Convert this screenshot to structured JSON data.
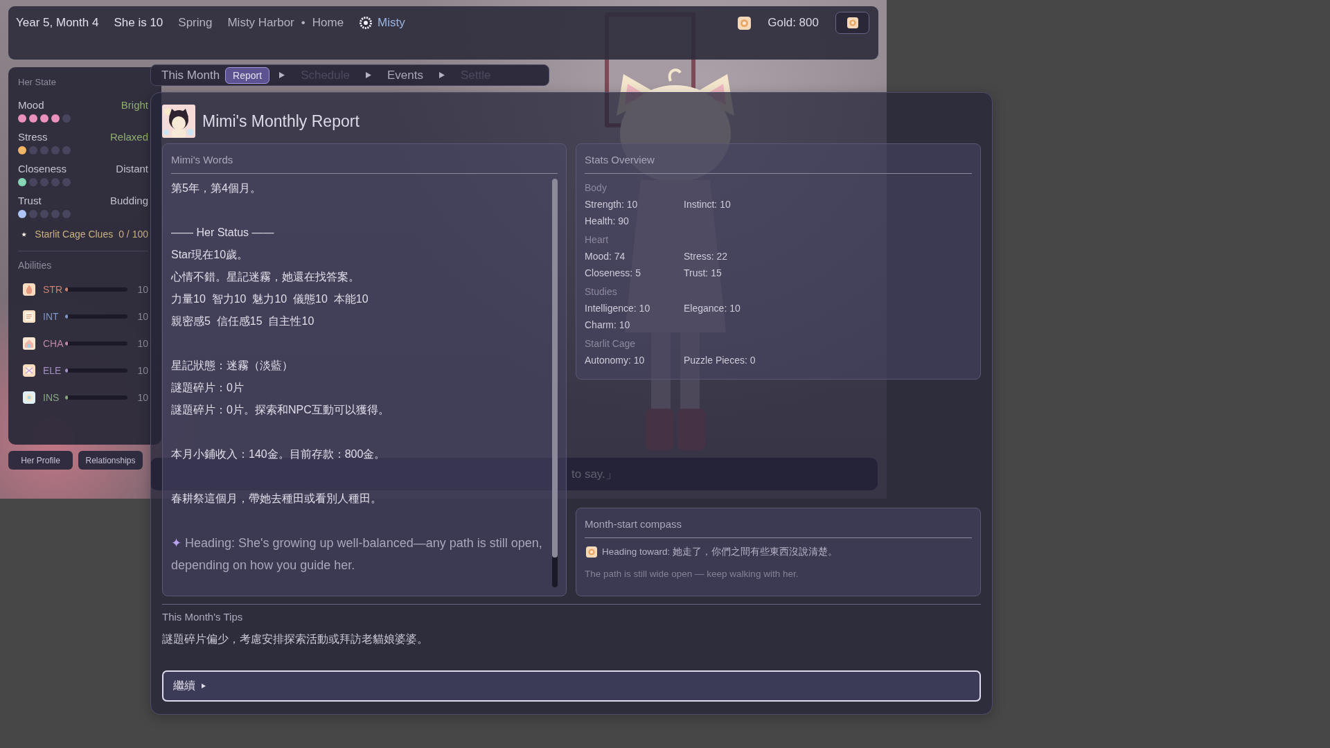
{
  "top_bar": {
    "date": "Year 5, Month 4",
    "age": "She is 10",
    "season": "Spring",
    "location": "Misty Harbor",
    "separator": "•",
    "place": "Home",
    "weather": "Misty",
    "gold": "Gold: 800"
  },
  "steps_bar": {
    "label": "This Month",
    "steps": [
      {
        "label": "Report",
        "selected": true,
        "disabled": false
      },
      {
        "label": "Schedule",
        "selected": false,
        "disabled": true
      },
      {
        "label": "Events",
        "selected": false,
        "disabled": false
      },
      {
        "label": "Settle",
        "selected": false,
        "disabled": true
      }
    ]
  },
  "her_state": {
    "title": "Her State",
    "meters": [
      {
        "label": "Mood",
        "value": "Bright",
        "positive": true,
        "stars": 4,
        "color": "#e991bb"
      },
      {
        "label": "Stress",
        "value": "Relaxed",
        "positive": true,
        "stars": 1,
        "color": "#f3b566"
      },
      {
        "label": "Closeness",
        "value": "Distant",
        "positive": false,
        "stars": 1,
        "color": "#86d6b6"
      },
      {
        "label": "Trust",
        "value": "Budding",
        "positive": false,
        "stars": 1,
        "color": "#aec4f4"
      }
    ],
    "clues": {
      "label": "Starlit Cage Clues",
      "count": "0 / 100"
    }
  },
  "abilities": {
    "title": "Abilities",
    "items": [
      {
        "label": "STR",
        "color": "#c98474",
        "level": 0.04,
        "value": "10"
      },
      {
        "label": "INT",
        "color": "#8196c8",
        "level": 0.04,
        "value": "10"
      },
      {
        "label": "CHA",
        "color": "#b987a8",
        "level": 0.04,
        "value": "10"
      },
      {
        "label": "ELE",
        "color": "#a38fc0",
        "level": 0.04,
        "value": "10"
      },
      {
        "label": "INS",
        "color": "#86a883",
        "level": 0.04,
        "value": "10"
      }
    ]
  },
  "side_buttons": [
    "Her Profile",
    "Relationships"
  ],
  "dialogue": {
    "text": "to say.」"
  },
  "report": {
    "title": "Mimi's Monthly Report",
    "words": {
      "title": "Mimi's Words",
      "paragraphs": [
        {
          "kind": "plain",
          "lines": [
            "第5年，第4個月。"
          ]
        },
        {
          "kind": "plain",
          "lines": [
            "—— Her Status ——",
            "Star現在10歲。",
            "心情不錯。星記迷霧，她還在找答案。",
            "力量10  智力10  魅力10  儀態10  本能10",
            "親密感5  信任感15  自主性10"
          ]
        },
        {
          "kind": "plain",
          "lines": [
            "星記狀態：迷霧（淡藍）",
            "謎題碎片：0片",
            "謎題碎片：0片。探索和NPC互動可以獲得。"
          ]
        },
        {
          "kind": "plain",
          "lines": [
            "本月小鋪收入：140金。目前存款：800金。"
          ]
        },
        {
          "kind": "plain",
          "lines": [
            "春耕祭這個月，帶她去種田或看別人種田。"
          ]
        },
        {
          "kind": "heading",
          "glyph": "✦",
          "text": "Heading: She's growing up well-balanced—any path is still open, depending on how you guide her."
        }
      ]
    },
    "stats": {
      "title": "Stats Overview",
      "groups": [
        {
          "name": "Body",
          "items": [
            "Strength: 10",
            "Instinct: 10",
            "Health: 90"
          ]
        },
        {
          "name": "Heart",
          "items": [
            "Mood: 74",
            "Stress: 22",
            "Closeness: 5",
            "Trust: 15"
          ]
        },
        {
          "name": "Studies",
          "items": [
            "Intelligence: 10",
            "Elegance: 10",
            "Charm: 10"
          ]
        },
        {
          "name": "Starlit Cage",
          "items": [
            "Autonomy: 10",
            "Puzzle Pieces: 0"
          ]
        }
      ]
    },
    "compass": {
      "title": "Month-start compass",
      "heading": "Heading toward: 她走了，你們之間有些東西沒說清楚。",
      "note": "The path is still wide open — keep walking with her."
    },
    "tips": {
      "title": "This Month's Tips",
      "text": "謎題碎片偏少，考慮安排探索活動或拜訪老貓娘婆婆。"
    },
    "continue_label": "繼續"
  }
}
